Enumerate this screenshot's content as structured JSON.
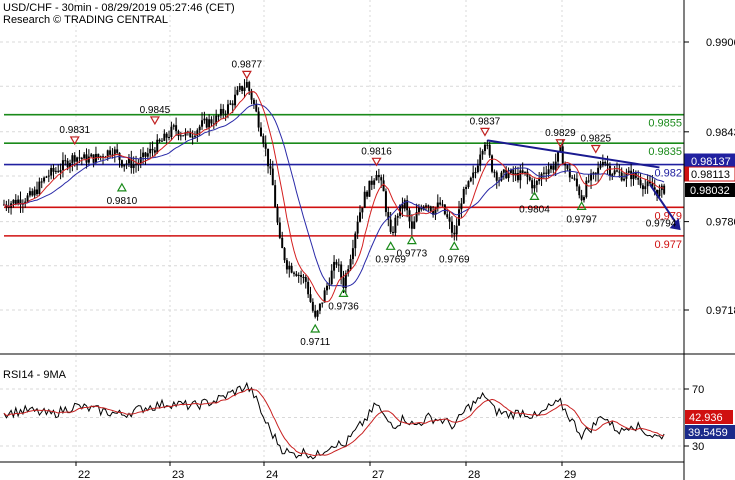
{
  "header": {
    "line1": "USD/CHF - 30min - 08/29/2019 05:27:46 (CET)",
    "line2": "Research © TRADING CENTRAL"
  },
  "colors": {
    "candle": "#000000",
    "ma_red": "#d42020",
    "ma_blue": "#2a2aa8",
    "green_level": "#1a8a1a",
    "red_level": "#d01010",
    "blue_level": "#2020a0",
    "arrow": "#1a1a90",
    "current_price_bg": "#000000",
    "rsi_line": "#000000",
    "rsi_ma": "#c82020",
    "rsi_current_bg": "#1a2a8a",
    "rsi_ma_bg": "#d01010",
    "grid": "#d9d9d9"
  },
  "chart_data": [
    {
      "type": "candlestick",
      "title": "USD/CHF - 30min",
      "x_tick_labels": [
        "22",
        "23",
        "24",
        "27",
        "28",
        "29"
      ],
      "y_tick_labels": [
        "0.9906",
        "0.9843",
        "0.9780",
        "0.9718"
      ],
      "ylim": [
        0.9697,
        0.992
      ],
      "grid": true,
      "close_path": [
        [
          0,
          0.9792
        ],
        [
          6,
          0.9795
        ],
        [
          12,
          0.9798
        ],
        [
          18,
          0.9812
        ],
        [
          24,
          0.9818
        ],
        [
          30,
          0.9826
        ],
        [
          34,
          0.9824
        ],
        [
          40,
          0.9825
        ],
        [
          46,
          0.9831
        ],
        [
          50,
          0.9822
        ],
        [
          56,
          0.982
        ],
        [
          60,
          0.9826
        ],
        [
          64,
          0.9832
        ],
        [
          68,
          0.9838
        ],
        [
          72,
          0.9845
        ],
        [
          78,
          0.984
        ],
        [
          84,
          0.9848
        ],
        [
          90,
          0.9852
        ],
        [
          96,
          0.9862
        ],
        [
          100,
          0.9872
        ],
        [
          103,
          0.9877
        ],
        [
          106,
          0.9862
        ],
        [
          110,
          0.9838
        ],
        [
          114,
          0.9805
        ],
        [
          117,
          0.9765
        ],
        [
          120,
          0.975
        ],
        [
          124,
          0.9745
        ],
        [
          128,
          0.9738
        ],
        [
          130,
          0.9724
        ],
        [
          132,
          0.9711
        ],
        [
          135,
          0.9725
        ],
        [
          138,
          0.974
        ],
        [
          141,
          0.9752
        ],
        [
          144,
          0.9736
        ],
        [
          147,
          0.9757
        ],
        [
          150,
          0.9782
        ],
        [
          153,
          0.9798
        ],
        [
          156,
          0.9808
        ],
        [
          158,
          0.9816
        ],
        [
          161,
          0.98
        ],
        [
          164,
          0.9769
        ],
        [
          167,
          0.9786
        ],
        [
          170,
          0.9793
        ],
        [
          173,
          0.9773
        ],
        [
          176,
          0.979
        ],
        [
          179,
          0.9794
        ],
        [
          182,
          0.9788
        ],
        [
          185,
          0.9792
        ],
        [
          188,
          0.9782
        ],
        [
          191,
          0.9769
        ],
        [
          194,
          0.9796
        ],
        [
          197,
          0.9805
        ],
        [
          200,
          0.9815
        ],
        [
          202,
          0.983
        ],
        [
          204,
          0.9837
        ],
        [
          207,
          0.9818
        ],
        [
          210,
          0.981
        ],
        [
          213,
          0.9814
        ],
        [
          217,
          0.9812
        ],
        [
          221,
          0.9813
        ],
        [
          225,
          0.9804
        ],
        [
          229,
          0.9816
        ],
        [
          233,
          0.9819
        ],
        [
          236,
          0.9829
        ],
        [
          239,
          0.9815
        ],
        [
          242,
          0.9808
        ],
        [
          245,
          0.9797
        ],
        [
          248,
          0.9809
        ],
        [
          251,
          0.9812
        ],
        [
          254,
          0.9825
        ],
        [
          257,
          0.9816
        ],
        [
          260,
          0.9814
        ],
        [
          263,
          0.9812
        ],
        [
          266,
          0.9813
        ],
        [
          269,
          0.981
        ],
        [
          272,
          0.9805
        ],
        [
          275,
          0.9804
        ],
        [
          278,
          0.98
        ],
        [
          280,
          0.9803
        ]
      ],
      "annotations": [
        {
          "text": "0.9831",
          "x": 30,
          "price": 0.9831,
          "marker": "down"
        },
        {
          "text": "0.9845",
          "x": 64,
          "price": 0.9845,
          "marker": "down"
        },
        {
          "text": "0.9810",
          "x": 50,
          "price": 0.981,
          "marker": "up"
        },
        {
          "text": "0.9877",
          "x": 103,
          "price": 0.9877,
          "marker": "down"
        },
        {
          "text": "0.9711",
          "x": 132,
          "price": 0.9711,
          "marker": "up"
        },
        {
          "text": "0.9736",
          "x": 144,
          "price": 0.9736,
          "marker": "up"
        },
        {
          "text": "0.9816",
          "x": 158,
          "price": 0.9816,
          "marker": "down"
        },
        {
          "text": "0.9769",
          "x": 164,
          "price": 0.9769,
          "marker": "up"
        },
        {
          "text": "0.9773",
          "x": 173,
          "price": 0.9773,
          "marker": "up"
        },
        {
          "text": "0.9769",
          "x": 191,
          "price": 0.9769,
          "marker": "up"
        },
        {
          "text": "0.9837",
          "x": 204,
          "price": 0.9837,
          "marker": "down"
        },
        {
          "text": "0.9804",
          "x": 225,
          "price": 0.9804,
          "marker": "up"
        },
        {
          "text": "0.9829",
          "x": 236,
          "price": 0.9829,
          "marker": "down"
        },
        {
          "text": "0.9797",
          "x": 245,
          "price": 0.9797,
          "marker": "up"
        },
        {
          "text": "0.9825",
          "x": 251,
          "price": 0.9825,
          "marker": "down"
        },
        {
          "text": "0.9794",
          "x": 277,
          "price": 0.9794,
          "marker": "none"
        }
      ],
      "levels": [
        {
          "label": "0.9855",
          "price": 0.9855,
          "color": "green"
        },
        {
          "label": "0.9835",
          "price": 0.9835,
          "color": "green"
        },
        {
          "label": "0.982",
          "price": 0.982,
          "color": "blue"
        },
        {
          "label": "0.979",
          "price": 0.979,
          "color": "red"
        },
        {
          "label": "0.977",
          "price": 0.977,
          "color": "red"
        }
      ],
      "price_tags": [
        {
          "label": "0.98137",
          "price": 0.98137,
          "style": "blue"
        },
        {
          "label": "0.98113",
          "price": 0.98113,
          "style": "red"
        },
        {
          "label": "0.98032",
          "price": 0.98032,
          "style": "black"
        }
      ],
      "trendline": {
        "from": [
          205,
          0.9837
        ],
        "to": [
          278,
          0.9818
        ]
      },
      "projection": {
        "from": [
          274,
          0.9806
        ],
        "to": [
          287,
          0.9774
        ]
      }
    },
    {
      "type": "line",
      "title": "RSI14 - 9MA",
      "y_tick_labels": [
        "70",
        "30"
      ],
      "ylim": [
        20,
        80
      ],
      "current_rsi": "39.5459",
      "current_ma": "42.936",
      "rsi_path": [
        [
          0,
          53
        ],
        [
          10,
          55
        ],
        [
          20,
          52
        ],
        [
          30,
          58
        ],
        [
          40,
          55
        ],
        [
          50,
          52
        ],
        [
          60,
          57
        ],
        [
          70,
          60
        ],
        [
          80,
          58
        ],
        [
          90,
          62
        ],
        [
          100,
          70
        ],
        [
          103,
          72
        ],
        [
          106,
          66
        ],
        [
          110,
          50
        ],
        [
          114,
          38
        ],
        [
          118,
          28
        ],
        [
          122,
          24
        ],
        [
          128,
          26
        ],
        [
          132,
          22
        ],
        [
          136,
          28
        ],
        [
          140,
          32
        ],
        [
          144,
          30
        ],
        [
          150,
          42
        ],
        [
          156,
          54
        ],
        [
          158,
          60
        ],
        [
          162,
          48
        ],
        [
          166,
          45
        ],
        [
          170,
          50
        ],
        [
          174,
          44
        ],
        [
          180,
          50
        ],
        [
          186,
          48
        ],
        [
          191,
          44
        ],
        [
          196,
          56
        ],
        [
          202,
          63
        ],
        [
          204,
          66
        ],
        [
          208,
          55
        ],
        [
          214,
          52
        ],
        [
          220,
          54
        ],
        [
          226,
          50
        ],
        [
          232,
          58
        ],
        [
          236,
          60
        ],
        [
          240,
          50
        ],
        [
          245,
          38
        ],
        [
          250,
          44
        ],
        [
          254,
          52
        ],
        [
          258,
          44
        ],
        [
          262,
          40
        ],
        [
          266,
          46
        ],
        [
          270,
          42
        ],
        [
          274,
          38
        ],
        [
          278,
          36
        ],
        [
          280,
          39.5
        ]
      ]
    }
  ]
}
